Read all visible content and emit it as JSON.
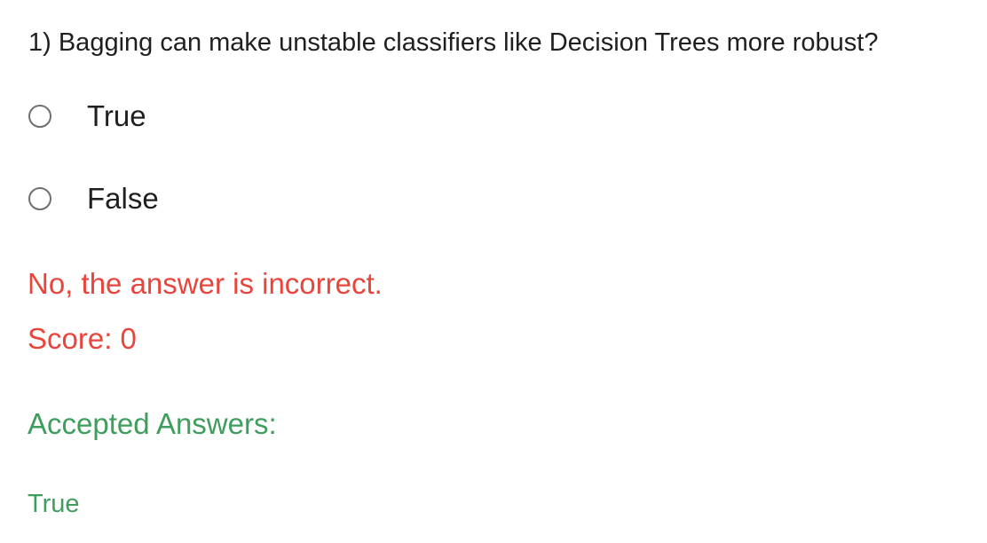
{
  "question": {
    "text": "1) Bagging can make unstable classifiers like Decision Trees more robust?"
  },
  "options": [
    {
      "label": "True",
      "selected": false
    },
    {
      "label": "False",
      "selected": false
    }
  ],
  "feedback": {
    "message": "No, the answer is incorrect.",
    "score_label": "Score: 0",
    "color": "#e8453c"
  },
  "accepted": {
    "heading": "Accepted Answers:",
    "answer": "True",
    "color": "#3f9e5d"
  }
}
